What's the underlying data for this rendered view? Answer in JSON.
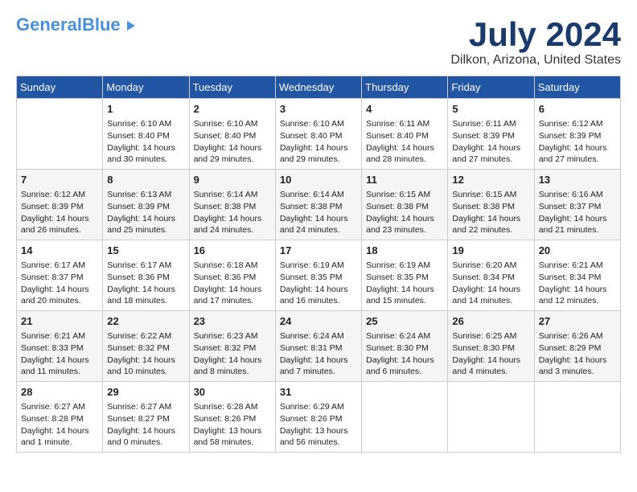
{
  "header": {
    "logo_general": "General",
    "logo_blue": "Blue",
    "month_title": "July 2024",
    "location": "Dilkon, Arizona, United States"
  },
  "weekdays": [
    "Sunday",
    "Monday",
    "Tuesday",
    "Wednesday",
    "Thursday",
    "Friday",
    "Saturday"
  ],
  "weeks": [
    [
      {
        "day": "",
        "content": ""
      },
      {
        "day": "1",
        "content": "Sunrise: 6:10 AM\nSunset: 8:40 PM\nDaylight: 14 hours\nand 30 minutes."
      },
      {
        "day": "2",
        "content": "Sunrise: 6:10 AM\nSunset: 8:40 PM\nDaylight: 14 hours\nand 29 minutes."
      },
      {
        "day": "3",
        "content": "Sunrise: 6:10 AM\nSunset: 8:40 PM\nDaylight: 14 hours\nand 29 minutes."
      },
      {
        "day": "4",
        "content": "Sunrise: 6:11 AM\nSunset: 8:40 PM\nDaylight: 14 hours\nand 28 minutes."
      },
      {
        "day": "5",
        "content": "Sunrise: 6:11 AM\nSunset: 8:39 PM\nDaylight: 14 hours\nand 27 minutes."
      },
      {
        "day": "6",
        "content": "Sunrise: 6:12 AM\nSunset: 8:39 PM\nDaylight: 14 hours\nand 27 minutes."
      }
    ],
    [
      {
        "day": "7",
        "content": "Sunrise: 6:12 AM\nSunset: 8:39 PM\nDaylight: 14 hours\nand 26 minutes."
      },
      {
        "day": "8",
        "content": "Sunrise: 6:13 AM\nSunset: 8:39 PM\nDaylight: 14 hours\nand 25 minutes."
      },
      {
        "day": "9",
        "content": "Sunrise: 6:14 AM\nSunset: 8:38 PM\nDaylight: 14 hours\nand 24 minutes."
      },
      {
        "day": "10",
        "content": "Sunrise: 6:14 AM\nSunset: 8:38 PM\nDaylight: 14 hours\nand 24 minutes."
      },
      {
        "day": "11",
        "content": "Sunrise: 6:15 AM\nSunset: 8:38 PM\nDaylight: 14 hours\nand 23 minutes."
      },
      {
        "day": "12",
        "content": "Sunrise: 6:15 AM\nSunset: 8:38 PM\nDaylight: 14 hours\nand 22 minutes."
      },
      {
        "day": "13",
        "content": "Sunrise: 6:16 AM\nSunset: 8:37 PM\nDaylight: 14 hours\nand 21 minutes."
      }
    ],
    [
      {
        "day": "14",
        "content": "Sunrise: 6:17 AM\nSunset: 8:37 PM\nDaylight: 14 hours\nand 20 minutes."
      },
      {
        "day": "15",
        "content": "Sunrise: 6:17 AM\nSunset: 8:36 PM\nDaylight: 14 hours\nand 18 minutes."
      },
      {
        "day": "16",
        "content": "Sunrise: 6:18 AM\nSunset: 8:36 PM\nDaylight: 14 hours\nand 17 minutes."
      },
      {
        "day": "17",
        "content": "Sunrise: 6:19 AM\nSunset: 8:35 PM\nDaylight: 14 hours\nand 16 minutes."
      },
      {
        "day": "18",
        "content": "Sunrise: 6:19 AM\nSunset: 8:35 PM\nDaylight: 14 hours\nand 15 minutes."
      },
      {
        "day": "19",
        "content": "Sunrise: 6:20 AM\nSunset: 8:34 PM\nDaylight: 14 hours\nand 14 minutes."
      },
      {
        "day": "20",
        "content": "Sunrise: 6:21 AM\nSunset: 8:34 PM\nDaylight: 14 hours\nand 12 minutes."
      }
    ],
    [
      {
        "day": "21",
        "content": "Sunrise: 6:21 AM\nSunset: 8:33 PM\nDaylight: 14 hours\nand 11 minutes."
      },
      {
        "day": "22",
        "content": "Sunrise: 6:22 AM\nSunset: 8:32 PM\nDaylight: 14 hours\nand 10 minutes."
      },
      {
        "day": "23",
        "content": "Sunrise: 6:23 AM\nSunset: 8:32 PM\nDaylight: 14 hours\nand 8 minutes."
      },
      {
        "day": "24",
        "content": "Sunrise: 6:24 AM\nSunset: 8:31 PM\nDaylight: 14 hours\nand 7 minutes."
      },
      {
        "day": "25",
        "content": "Sunrise: 6:24 AM\nSunset: 8:30 PM\nDaylight: 14 hours\nand 6 minutes."
      },
      {
        "day": "26",
        "content": "Sunrise: 6:25 AM\nSunset: 8:30 PM\nDaylight: 14 hours\nand 4 minutes."
      },
      {
        "day": "27",
        "content": "Sunrise: 6:26 AM\nSunset: 8:29 PM\nDaylight: 14 hours\nand 3 minutes."
      }
    ],
    [
      {
        "day": "28",
        "content": "Sunrise: 6:27 AM\nSunset: 8:28 PM\nDaylight: 14 hours\nand 1 minute."
      },
      {
        "day": "29",
        "content": "Sunrise: 6:27 AM\nSunset: 8:27 PM\nDaylight: 14 hours\nand 0 minutes."
      },
      {
        "day": "30",
        "content": "Sunrise: 6:28 AM\nSunset: 8:26 PM\nDaylight: 13 hours\nand 58 minutes."
      },
      {
        "day": "31",
        "content": "Sunrise: 6:29 AM\nSunset: 8:26 PM\nDaylight: 13 hours\nand 56 minutes."
      },
      {
        "day": "",
        "content": ""
      },
      {
        "day": "",
        "content": ""
      },
      {
        "day": "",
        "content": ""
      }
    ]
  ]
}
